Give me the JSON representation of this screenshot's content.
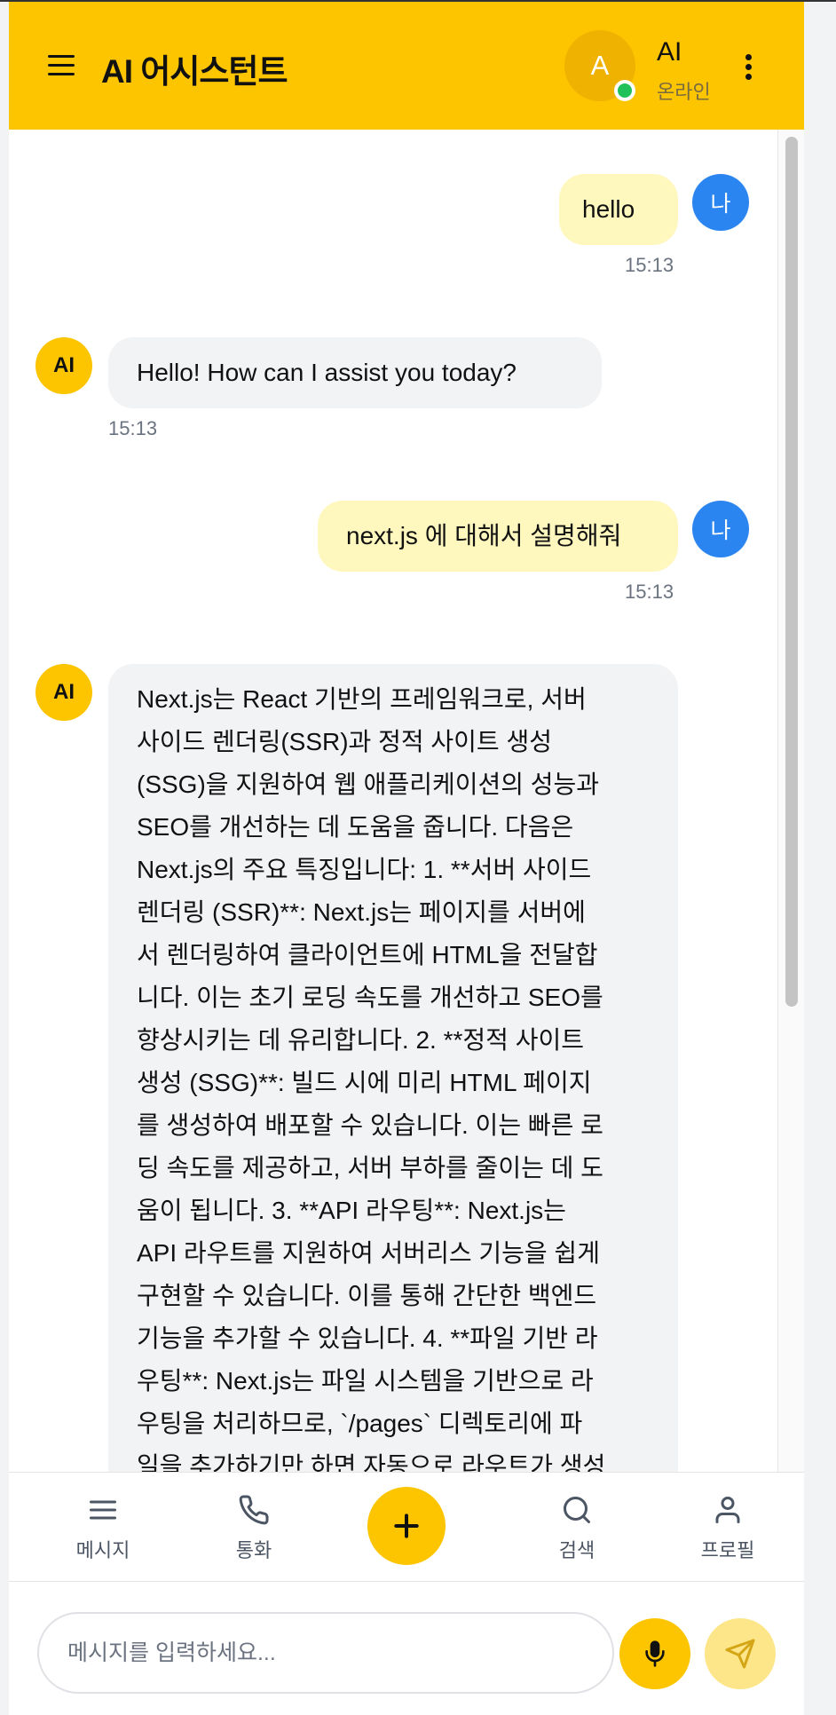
{
  "header": {
    "app_title": "AI 어시스턴트",
    "avatar_letter": "A",
    "contact_name": "AI",
    "contact_status": "온라인",
    "brand_color": "#fcc500"
  },
  "messages": [
    {
      "sender": "user",
      "avatar": "나",
      "text": "hello",
      "time": "15:13"
    },
    {
      "sender": "ai",
      "avatar": "AI",
      "text": "Hello! How can I assist you today?",
      "time": "15:13"
    },
    {
      "sender": "user",
      "avatar": "나",
      "text": "next.js 에 대해서 설명해줘",
      "time": "15:13"
    },
    {
      "sender": "ai",
      "avatar": "AI",
      "lines": [
        "Next.js는 React 기반의 프레임워크로, 서버",
        "사이드 렌더링(SSR)과 정적 사이트 생성",
        "(SSG)을 지원하여 웹 애플리케이션의 성능과",
        "SEO를 개선하는 데 도움을 줍니다. 다음은",
        "Next.js의 주요 특징입니다: 1. **서버 사이드",
        "렌더링 (SSR)**: Next.js는 페이지를 서버에",
        "서 렌더링하여 클라이언트에 HTML을 전달합",
        "니다. 이는 초기 로딩 속도를 개선하고 SEO를",
        "향상시키는 데 유리합니다. 2. **정적 사이트",
        "생성 (SSG)**: 빌드 시에 미리 HTML 페이지",
        "를 생성하여 배포할 수 있습니다. 이는 빠른 로",
        "딩 속도를 제공하고, 서버 부하를 줄이는 데 도",
        "움이 됩니다. 3. **API 라우팅**: Next.js는",
        "API 라우트를 지원하여 서버리스 기능을 쉽게",
        "구현할 수 있습니다. 이를 통해 간단한 백엔드",
        "기능을 추가할 수 있습니다. 4. **파일 기반 라",
        "우팅**: Next.js는 파일 시스템을 기반으로 라",
        "우팅을 처리하므로, `/pages` 디렉토리에 파",
        "일을 추가하기만 하면 자동으로 라우트가 생성"
      ]
    }
  ],
  "bottom_nav": {
    "items": [
      {
        "label": "메시지",
        "icon": "menu-lines-icon"
      },
      {
        "label": "통화",
        "icon": "phone-icon"
      },
      {
        "label": "검색",
        "icon": "search-icon"
      },
      {
        "label": "프로필",
        "icon": "user-icon"
      }
    ],
    "fab_icon": "plus-icon"
  },
  "composer": {
    "placeholder": "메시지를 입력하세요...",
    "value": "",
    "mic_icon": "microphone-icon",
    "send_icon": "send-icon"
  }
}
